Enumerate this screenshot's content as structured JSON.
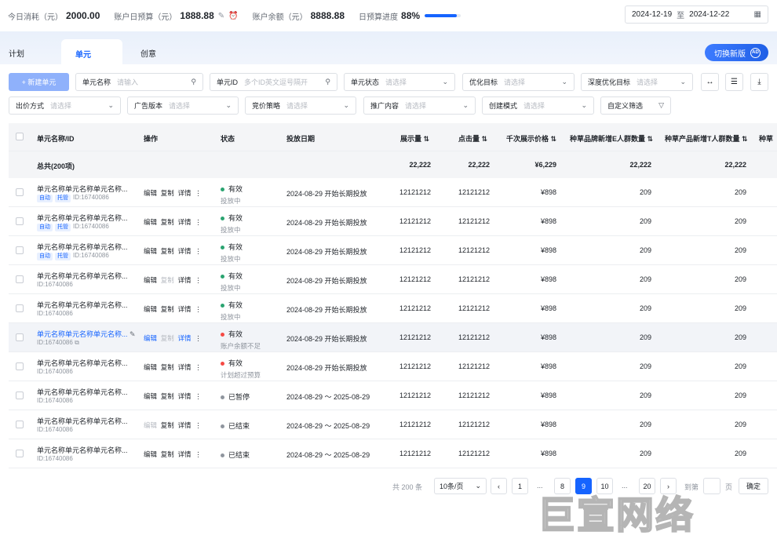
{
  "top": {
    "metrics": [
      {
        "label": "今日消耗（元）",
        "value": "2000.00"
      },
      {
        "label": "账户日预算（元）",
        "value": "1888.88"
      },
      {
        "label": "账户余额（元）",
        "value": "8888.88"
      },
      {
        "label": "日预算进度",
        "value": "88%"
      }
    ],
    "progress": 0.88,
    "date_start": "2024-12-19",
    "date_sep": "至",
    "date_end": "2024-12-22"
  },
  "tabs": [
    "计划",
    "单元",
    "创意"
  ],
  "switch_label": "切换新版",
  "switch_badge": "AD",
  "new_button": "+ 新建单元",
  "filters": [
    {
      "label": "单元名称",
      "placeholder": "请输入"
    },
    {
      "label": "单元ID",
      "placeholder": "多个ID英文逗号隔开"
    },
    {
      "label": "单元状态",
      "placeholder": "请选择"
    },
    {
      "label": "优化目标",
      "placeholder": "请选择"
    },
    {
      "label": "深度优化目标",
      "placeholder": "请选择"
    },
    {
      "label": "出价方式",
      "placeholder": "请选择"
    },
    {
      "label": "广告版本",
      "placeholder": "请选择"
    },
    {
      "label": "竞价策略",
      "placeholder": "请选择"
    },
    {
      "label": "推广内容",
      "placeholder": "请选择"
    },
    {
      "label": "创建模式",
      "placeholder": "请选择"
    },
    {
      "label": "自定义筛选",
      "placeholder": ""
    }
  ],
  "columns": [
    "单元名称/ID",
    "操作",
    "状态",
    "投放日期",
    "展示量",
    "点击量",
    "千次展示价格",
    "种草品牌新增E人群数量",
    "种草产品新增T人群数量",
    "种草"
  ],
  "summary": {
    "label": "总共(200项)",
    "impressions": "22,222",
    "clicks": "22,222",
    "cpm": "¥6,229",
    "e_crowd": "22,222",
    "t_crowd": "22,222"
  },
  "ops": {
    "edit": "编辑",
    "copy": "复制",
    "detail": "详情",
    "more": "⋮"
  },
  "rows": [
    {
      "name": "单元名称单元名称单元名称...",
      "tags": [
        "自动",
        "托管"
      ],
      "id": "ID:16740086",
      "status": "有效",
      "status_color": "#2ba471",
      "sub": "投放中",
      "date": "2024-08-29 开始长期投放",
      "imp": "12121212",
      "clk": "12121212",
      "cpm": "¥898",
      "e": "209",
      "t": "209",
      "copy_disabled": false,
      "edit_disabled": false
    },
    {
      "name": "单元名称单元名称单元名称...",
      "tags": [
        "自动",
        "托管"
      ],
      "id": "ID:16740086",
      "status": "有效",
      "status_color": "#2ba471",
      "sub": "投放中",
      "date": "2024-08-29 开始长期投放",
      "imp": "12121212",
      "clk": "12121212",
      "cpm": "¥898",
      "e": "209",
      "t": "209",
      "copy_disabled": false,
      "edit_disabled": false
    },
    {
      "name": "单元名称单元名称单元名称...",
      "tags": [
        "自动",
        "托管"
      ],
      "id": "ID:16740086",
      "status": "有效",
      "status_color": "#2ba471",
      "sub": "投放中",
      "date": "2024-08-29 开始长期投放",
      "imp": "12121212",
      "clk": "12121212",
      "cpm": "¥898",
      "e": "209",
      "t": "209",
      "copy_disabled": false,
      "edit_disabled": false
    },
    {
      "name": "单元名称单元名称单元名称...",
      "tags": [],
      "id": "ID:16740086",
      "status": "有效",
      "status_color": "#2ba471",
      "sub": "投放中",
      "date": "2024-08-29 开始长期投放",
      "imp": "12121212",
      "clk": "12121212",
      "cpm": "¥898",
      "e": "209",
      "t": "209",
      "copy_disabled": true,
      "edit_disabled": false
    },
    {
      "name": "单元名称单元名称单元名称...",
      "tags": [],
      "id": "ID:16740086",
      "status": "有效",
      "status_color": "#2ba471",
      "sub": "投放中",
      "date": "2024-08-29 开始长期投放",
      "imp": "12121212",
      "clk": "12121212",
      "cpm": "¥898",
      "e": "209",
      "t": "209",
      "copy_disabled": false,
      "edit_disabled": false
    },
    {
      "name": "单元名称单元名称单元名称...",
      "tags": [],
      "id": "ID:16740086",
      "status": "有效",
      "status_color": "#f54a45",
      "sub": "账户余额不足",
      "date": "2024-08-29 开始长期投放",
      "imp": "12121212",
      "clk": "12121212",
      "cpm": "¥898",
      "e": "209",
      "t": "209",
      "copy_disabled": true,
      "edit_disabled": false,
      "highlight": true
    },
    {
      "name": "单元名称单元名称单元名称...",
      "tags": [],
      "id": "ID:16740086",
      "status": "有效",
      "status_color": "#f54a45",
      "sub": "计划超过预算",
      "date": "2024-08-29 开始长期投放",
      "imp": "12121212",
      "clk": "12121212",
      "cpm": "¥898",
      "e": "209",
      "t": "209",
      "copy_disabled": false,
      "edit_disabled": false
    },
    {
      "name": "单元名称单元名称单元名称...",
      "tags": [],
      "id": "ID:16740086",
      "status": "已暂停",
      "status_color": "#8f959e",
      "sub": "",
      "date": "2024-08-29 ～ 2025-08-29",
      "imp": "12121212",
      "clk": "12121212",
      "cpm": "¥898",
      "e": "209",
      "t": "209",
      "copy_disabled": false,
      "edit_disabled": false
    },
    {
      "name": "单元名称单元名称单元名称...",
      "tags": [],
      "id": "ID:16740086",
      "status": "已结束",
      "status_color": "#8f959e",
      "sub": "",
      "date": "2024-08-29 ～ 2025-08-29",
      "imp": "12121212",
      "clk": "12121212",
      "cpm": "¥898",
      "e": "209",
      "t": "209",
      "copy_disabled": false,
      "edit_disabled": true
    },
    {
      "name": "单元名称单元名称单元名称...",
      "tags": [],
      "id": "ID:16740086",
      "status": "已结束",
      "status_color": "#8f959e",
      "sub": "",
      "date": "2024-08-29 ～ 2025-08-29",
      "imp": "12121212",
      "clk": "12121212",
      "cpm": "¥898",
      "e": "209",
      "t": "209",
      "copy_disabled": false,
      "edit_disabled": false
    }
  ],
  "pagination": {
    "total": "共 200 条",
    "page_size": "10条/页",
    "pages": [
      "1",
      "...",
      "8",
      "9",
      "10",
      "...",
      "20"
    ],
    "current": "9",
    "goto": "到第",
    "page_unit": "页",
    "confirm": "确定"
  },
  "watermark": "巨宣网络"
}
